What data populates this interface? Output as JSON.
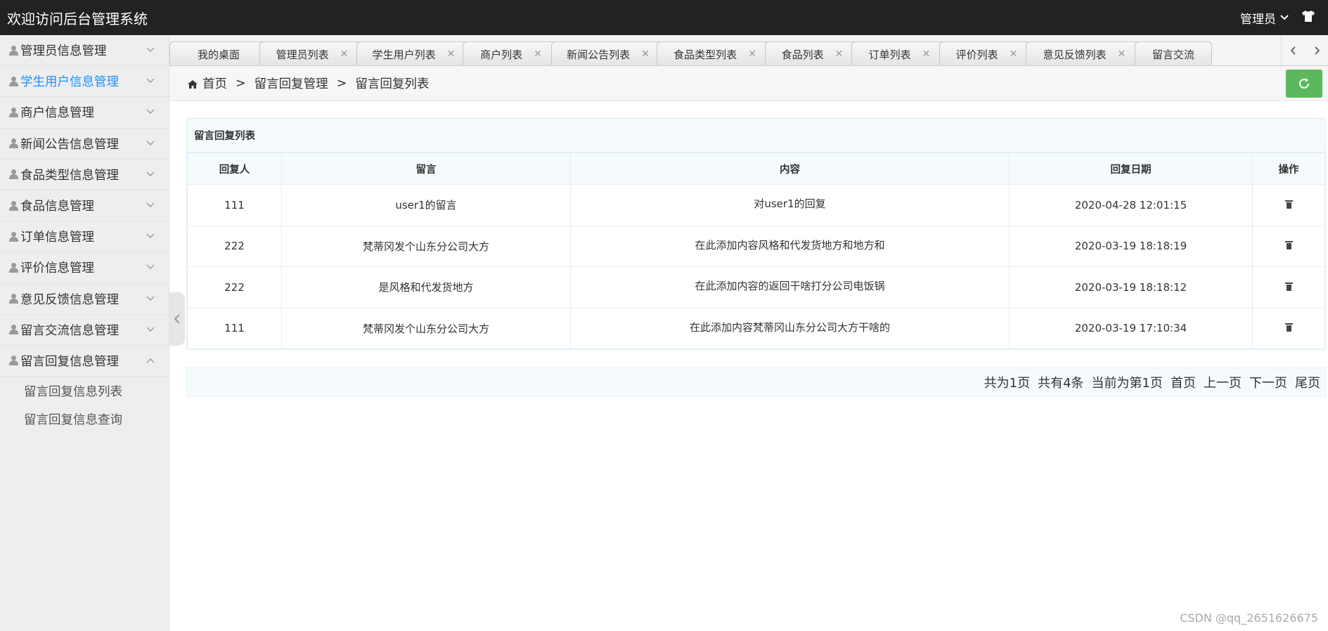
{
  "header": {
    "title": "欢迎访问后台管理系统",
    "user": "管理员",
    "shirt_icon": "tshirt-icon"
  },
  "sidebar": {
    "items": [
      {
        "label": "管理员信息管理",
        "active": false
      },
      {
        "label": "学生用户信息管理",
        "active": true
      },
      {
        "label": "商户信息管理",
        "active": false
      },
      {
        "label": "新闻公告信息管理",
        "active": false
      },
      {
        "label": "食品类型信息管理",
        "active": false
      },
      {
        "label": "食品信息管理",
        "active": false
      },
      {
        "label": "订单信息管理",
        "active": false
      },
      {
        "label": "评价信息管理",
        "active": false
      },
      {
        "label": "意见反馈信息管理",
        "active": false
      },
      {
        "label": "留言交流信息管理",
        "active": false
      },
      {
        "label": "留言回复信息管理",
        "active": false
      }
    ],
    "sub_items": [
      "留言回复信息列表",
      "留言回复信息查询"
    ]
  },
  "tabs": [
    {
      "label": "我的桌面",
      "closable": false
    },
    {
      "label": "管理员列表",
      "closable": true
    },
    {
      "label": "学生用户列表",
      "closable": true
    },
    {
      "label": "商户列表",
      "closable": true
    },
    {
      "label": "新闻公告列表",
      "closable": true
    },
    {
      "label": "食品类型列表",
      "closable": true
    },
    {
      "label": "食品列表",
      "closable": true
    },
    {
      "label": "订单列表",
      "closable": true
    },
    {
      "label": "评价列表",
      "closable": true
    },
    {
      "label": "意见反馈列表",
      "closable": true
    },
    {
      "label": "留言交流",
      "closable": false
    }
  ],
  "breadcrumb": {
    "home": "首页",
    "sep": ">",
    "level1": "留言回复管理",
    "level2": "留言回复列表"
  },
  "panel": {
    "title": "留言回复列表",
    "columns": [
      "回复人",
      "留言",
      "内容",
      "回复日期",
      "操作"
    ],
    "rows": [
      {
        "replier": "111",
        "message": "user1的留言",
        "content": "对user1的回复",
        "date": "2020-04-28 12:01:15"
      },
      {
        "replier": "222",
        "message": "梵蒂冈发个山东分公司大方",
        "content": "在此添加内容风格和代发货地方和地方和",
        "date": "2020-03-19 18:18:19"
      },
      {
        "replier": "222",
        "message": "是风格和代发货地方",
        "content": "在此添加内容的返回干啥打分公司电饭锅",
        "date": "2020-03-19 18:18:12"
      },
      {
        "replier": "111",
        "message": "梵蒂冈发个山东分公司大方",
        "content": "在此添加内容梵蒂冈山东分公司大方干啥的",
        "date": "2020-03-19 17:10:34"
      }
    ]
  },
  "pager": {
    "total_pages": "共为1页",
    "total_records": "共有4条",
    "current": "当前为第1页",
    "first": "首页",
    "prev": "上一页",
    "next": "下一页",
    "last": "尾页"
  },
  "watermark": "CSDN @qq_2651626675",
  "colors": {
    "topbar": "#222222",
    "active_link": "#1e90ff",
    "refresh": "#5cb85c"
  }
}
